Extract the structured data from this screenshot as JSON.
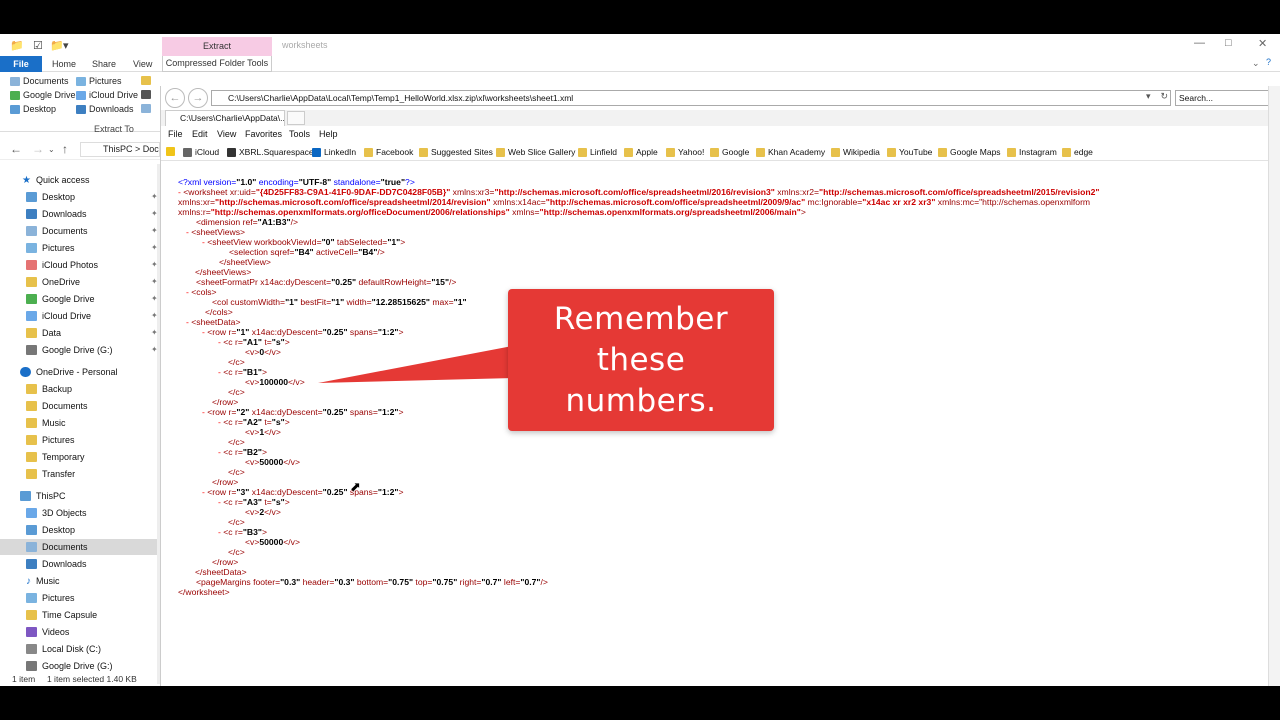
{
  "explorer": {
    "ribbon": {
      "extract_context": "Extract",
      "window_title": "worksheets",
      "tabs": [
        "File",
        "Home",
        "Share",
        "View"
      ],
      "compressed_tab": "Compressed Folder Tools",
      "quick_items": [
        "Documents",
        "Pictures",
        "Google Drive",
        "iCloud Drive",
        "Desktop",
        "Downloads"
      ],
      "extract_to": "Extract To",
      "accent_color": "#1a6fc8",
      "context_color": "#f7cbe4"
    },
    "path": "ThisPC  >  Doc",
    "sidebar": {
      "quick_access": "Quick access",
      "quick_items": [
        "Desktop",
        "Downloads",
        "Documents",
        "Pictures",
        "iCloud Photos",
        "OneDrive",
        "Google Drive",
        "iCloud Drive",
        "Data",
        "Google Drive (G:)"
      ],
      "onedrive_header": "OneDrive - Personal",
      "onedrive_items": [
        "Backup",
        "Documents",
        "Music",
        "Pictures",
        "Temporary",
        "Transfer"
      ],
      "thispc_header": "ThisPC",
      "thispc_items": [
        "3D Objects",
        "Desktop",
        "Documents",
        "Downloads",
        "Music",
        "Pictures",
        "Time Capsule",
        "Videos",
        "Local Disk (C:)",
        "Google Drive (G:)"
      ],
      "selected": "Documents"
    },
    "status": {
      "count": "1 item",
      "selection": "1 item selected  1.40 KB"
    }
  },
  "ie": {
    "url": "C:\\Users\\Charlie\\AppData\\Local\\Temp\\Temp1_HelloWorld.xlsx.zip\\xl\\worksheets\\sheet1.xml",
    "search_placeholder": "Search...",
    "tab_title": "C:\\Users\\Charlie\\AppData\\...",
    "menu": [
      "File",
      "Edit",
      "View",
      "Favorites",
      "Tools",
      "Help"
    ],
    "favorites": [
      "iCloud",
      "XBRL.Squarespace",
      "LinkedIn",
      "Facebook",
      "Suggested Sites",
      "Web Slice Gallery",
      "Linfield",
      "Apple",
      "Yahoo!",
      "Google",
      "Khan Academy",
      "Wikipedia",
      "YouTube",
      "Google Maps",
      "Instagram",
      "edge"
    ]
  },
  "xml": {
    "decl": "<?xml version=\"1.0\" encoding=\"UTF-8\" standalone=\"true\"?>",
    "ws_open_1": "- <worksheet xr:uid=\"{4D25FF83-C9A1-41F0-9DAF-DD7C0428F05B}\" xmlns:xr3=\"http://schemas.microsoft.com/office/spreadsheetml/2016/revision3\" xmlns:xr2=\"http://schemas.microsoft.com/office/spreadsheetml/2015/revision2\"",
    "ws_open_2": "xmlns:xr=\"http://schemas.microsoft.com/office/spreadsheetml/2014/revision\" xmlns:x14ac=\"http://schemas.microsoft.com/office/spreadsheetml/2009/9/ac\" mc:Ignorable=\"x14ac xr xr2 xr3\" xmlns:mc=\"http://schemas.openxmlform",
    "ws_open_3": "xmlns:r=\"http://schemas.openxmlformats.org/officeDocument/2006/relationships\" xmlns=\"http://schemas.openxmlformats.org/spreadsheetml/2006/main\">",
    "dimension": "<dimension ref=\"A1:B3\"/>",
    "sheetViews_open": "- <sheetViews>",
    "sheetView_open": "- <sheetView workbookViewId=\"0\" tabSelected=\"1\">",
    "selection": "<selection sqref=\"B4\" activeCell=\"B4\"/>",
    "sheetView_close": "</sheetView>",
    "sheetViews_close": "</sheetViews>",
    "sheetFormatPr": "<sheetFormatPr x14ac:dyDescent=\"0.25\" defaultRowHeight=\"15\"/>",
    "cols_open": "- <cols>",
    "col": "<col customWidth=\"1\" bestFit=\"1\" width=\"12.28515625\" max=\"1\"",
    "cols_close": "</cols>",
    "sheetData_open": "- <sheetData>",
    "rows": [
      {
        "open": "- <row r=\"1\" x14ac:dyDescent=\"0.25\" spans=\"1:2\">",
        "c1_open": "- <c r=\"A1\" t=\"s\">",
        "c1_v": "<v>0</v>",
        "c2_open": "- <c r=\"B1\">",
        "c2_v": "<v>100000</v>"
      },
      {
        "open": "- <row r=\"2\" x14ac:dyDescent=\"0.25\" spans=\"1:2\">",
        "c1_open": "- <c r=\"A2\" t=\"s\">",
        "c1_v": "<v>1</v>",
        "c2_open": "- <c r=\"B2\">",
        "c2_v": "<v>50000</v>"
      },
      {
        "open": "- <row r=\"3\" x14ac:dyDescent=\"0.25\" spans=\"1:2\">",
        "c1_open": "- <c r=\"A3\" t=\"s\">",
        "c1_v": "<v>2</v>",
        "c2_open": "- <c r=\"B3\">",
        "c2_v": "<v>50000</v>"
      }
    ],
    "c_close": "</c>",
    "row_close": "</row>",
    "sheetData_close": "</sheetData>",
    "pageMargins": "<pageMargins footer=\"0.3\" header=\"0.3\" bottom=\"0.75\" top=\"0.75\" right=\"0.7\" left=\"0.7\"/>",
    "ws_close": "</worksheet>"
  },
  "callout": {
    "line1": "Remember",
    "line2": "these",
    "line3": "numbers.",
    "color": "#e53935"
  }
}
